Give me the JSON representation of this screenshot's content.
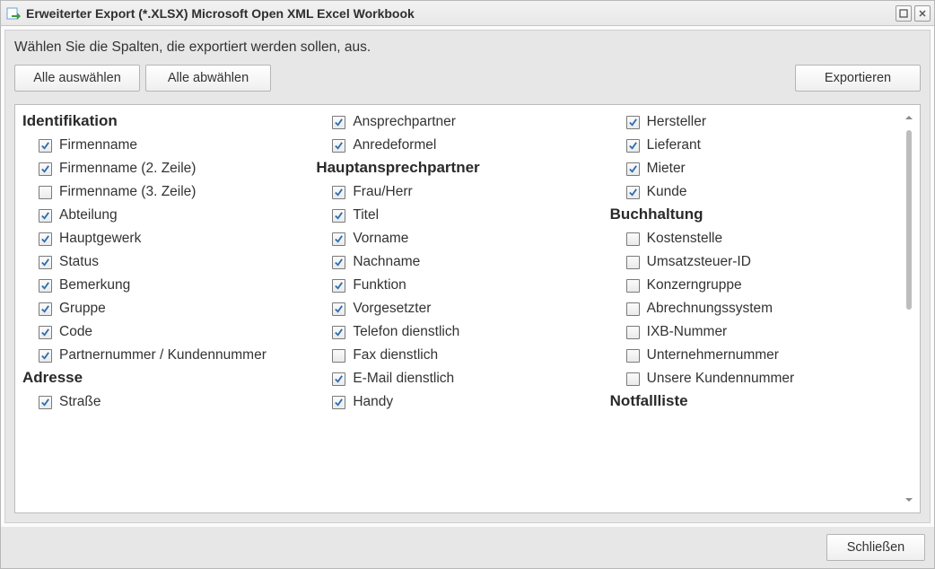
{
  "title": "Erweiterter Export (*.XLSX) Microsoft Open XML Excel Workbook",
  "instruction": "Wählen Sie die Spalten, die exportiert werden sollen, aus.",
  "buttons": {
    "select_all": "Alle auswählen",
    "deselect_all": "Alle abwählen",
    "export": "Exportieren",
    "close": "Schließen"
  },
  "columns": [
    [
      {
        "kind": "section",
        "label": "Identifikation"
      },
      {
        "kind": "item",
        "label": "Firmenname",
        "checked": true
      },
      {
        "kind": "item",
        "label": "Firmenname (2. Zeile)",
        "checked": true
      },
      {
        "kind": "item",
        "label": "Firmenname (3. Zeile)",
        "checked": false
      },
      {
        "kind": "item",
        "label": "Abteilung",
        "checked": true
      },
      {
        "kind": "item",
        "label": "Hauptgewerk",
        "checked": true
      },
      {
        "kind": "item",
        "label": "Status",
        "checked": true
      },
      {
        "kind": "item",
        "label": "Bemerkung",
        "checked": true
      },
      {
        "kind": "item",
        "label": "Gruppe",
        "checked": true
      },
      {
        "kind": "item",
        "label": "Code",
        "checked": true
      },
      {
        "kind": "item",
        "label": "Partnernummer / Kundennummer",
        "checked": true
      },
      {
        "kind": "section",
        "label": "Adresse"
      },
      {
        "kind": "item",
        "label": "Straße",
        "checked": true
      }
    ],
    [
      {
        "kind": "item",
        "label": "Ansprechpartner",
        "checked": true
      },
      {
        "kind": "item",
        "label": "Anredeformel",
        "checked": true
      },
      {
        "kind": "section",
        "label": "Hauptansprechpartner"
      },
      {
        "kind": "item",
        "label": "Frau/Herr",
        "checked": true
      },
      {
        "kind": "item",
        "label": "Titel",
        "checked": true
      },
      {
        "kind": "item",
        "label": "Vorname",
        "checked": true
      },
      {
        "kind": "item",
        "label": "Nachname",
        "checked": true
      },
      {
        "kind": "item",
        "label": "Funktion",
        "checked": true
      },
      {
        "kind": "item",
        "label": "Vorgesetzter",
        "checked": true
      },
      {
        "kind": "item",
        "label": "Telefon dienstlich",
        "checked": true
      },
      {
        "kind": "item",
        "label": "Fax dienstlich",
        "checked": false
      },
      {
        "kind": "item",
        "label": "E-Mail dienstlich",
        "checked": true
      },
      {
        "kind": "item",
        "label": "Handy",
        "checked": true
      }
    ],
    [
      {
        "kind": "item",
        "label": "Hersteller",
        "checked": true
      },
      {
        "kind": "item",
        "label": "Lieferant",
        "checked": true
      },
      {
        "kind": "item",
        "label": "Mieter",
        "checked": true
      },
      {
        "kind": "item",
        "label": "Kunde",
        "checked": true
      },
      {
        "kind": "section",
        "label": "Buchhaltung"
      },
      {
        "kind": "item",
        "label": "Kostenstelle",
        "checked": false
      },
      {
        "kind": "item",
        "label": "Umsatzsteuer-ID",
        "checked": false
      },
      {
        "kind": "item",
        "label": "Konzerngruppe",
        "checked": false
      },
      {
        "kind": "item",
        "label": "Abrechnungssystem",
        "checked": false
      },
      {
        "kind": "item",
        "label": "IXB-Nummer",
        "checked": false
      },
      {
        "kind": "item",
        "label": "Unternehmernummer",
        "checked": false
      },
      {
        "kind": "item",
        "label": "Unsere Kundennummer",
        "checked": false
      },
      {
        "kind": "section",
        "label": "Notfallliste"
      }
    ]
  ]
}
